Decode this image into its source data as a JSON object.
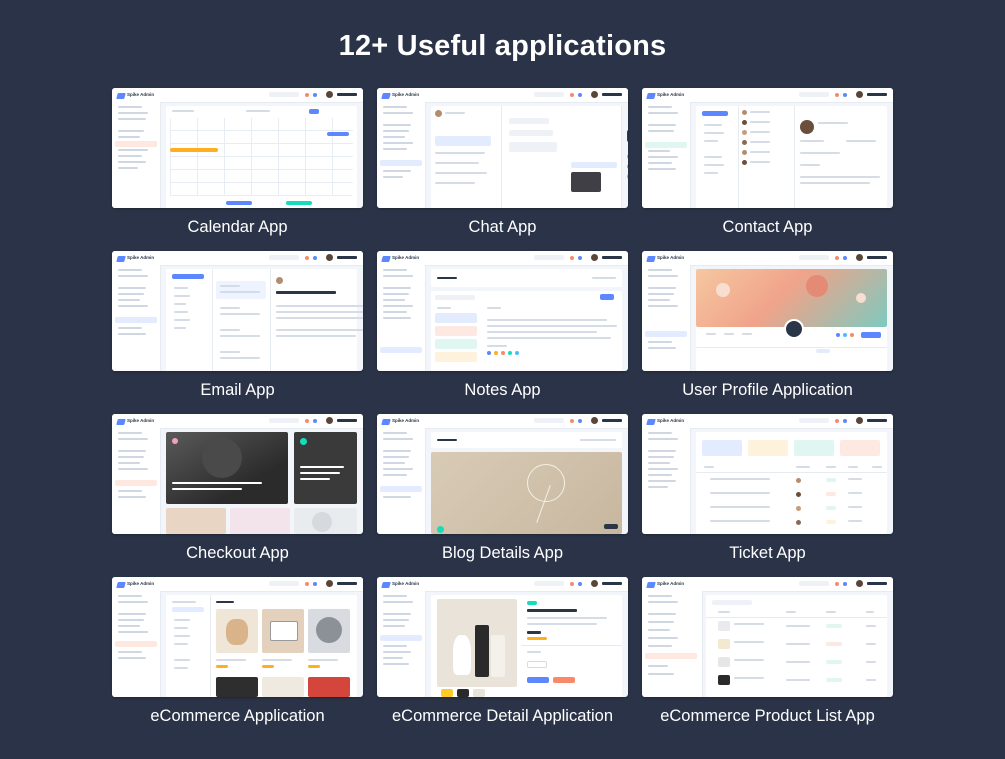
{
  "headline": "12+ Useful applications",
  "apps": [
    {
      "caption": "Calendar App",
      "shot_kind": "calendar"
    },
    {
      "caption": "Chat App",
      "shot_kind": "chat"
    },
    {
      "caption": "Contact App",
      "shot_kind": "contact"
    },
    {
      "caption": "Email App",
      "shot_kind": "email"
    },
    {
      "caption": "Notes App",
      "shot_kind": "notes"
    },
    {
      "caption": "User Profile Application",
      "shot_kind": "profile"
    },
    {
      "caption": "Checkout App",
      "shot_kind": "checkout"
    },
    {
      "caption": "Blog Details App",
      "shot_kind": "blog"
    },
    {
      "caption": "Ticket App",
      "shot_kind": "ticket"
    },
    {
      "caption": "eCommerce Application",
      "shot_kind": "ecommerce"
    },
    {
      "caption": "eCommerce Detail Application",
      "shot_kind": "ecommerce-detail"
    },
    {
      "caption": "eCommerce Product List App",
      "shot_kind": "product-list"
    }
  ],
  "mini_brand": "Spike Admin",
  "colors": {
    "background": "#2a3347",
    "caption_text": "#ffffff",
    "primary": "#5d87ff",
    "secondary": "#fa896b",
    "success": "#13deb9",
    "warning": "#ffae1f"
  }
}
